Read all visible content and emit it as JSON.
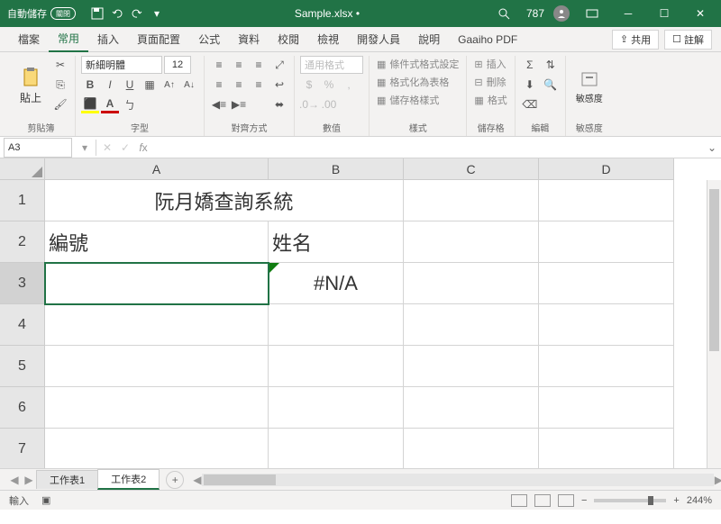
{
  "titlebar": {
    "autosave_label": "自動儲存",
    "autosave_state": "關閉",
    "filename": "Sample.xlsx •",
    "user_count": "787"
  },
  "tabs": {
    "file": "檔案",
    "home": "常用",
    "insert": "插入",
    "layout": "頁面配置",
    "formulas": "公式",
    "data": "資料",
    "review": "校閱",
    "view": "檢視",
    "dev": "開發人員",
    "help": "說明",
    "gaaiho": "Gaaiho PDF",
    "share": "共用",
    "comment": "註解"
  },
  "ribbon": {
    "clipboard": "剪貼簿",
    "paste": "貼上",
    "font_group": "字型",
    "font_name": "新細明體",
    "font_size": "12",
    "align_group": "對齊方式",
    "number_group": "數值",
    "styles_group": "樣式",
    "cells_group": "儲存格",
    "editing_group": "編輯",
    "sens_group": "敏感度",
    "sens_btn": "敏感度",
    "num_fmt": "通用格式",
    "cond_fmt": "條件式格式設定",
    "as_table": "格式化為表格",
    "cell_styles": "儲存格樣式",
    "insert_btn": "插入",
    "delete_btn": "刪除",
    "format_btn": "格式"
  },
  "formula_bar": {
    "name_box": "A3"
  },
  "columns": [
    "A",
    "B",
    "C",
    "D"
  ],
  "rows": [
    "1",
    "2",
    "3",
    "4",
    "5",
    "6",
    "7"
  ],
  "cells": {
    "title": "阮月嬌查詢系統",
    "a2": "編號",
    "b2": "姓名",
    "b3": "#N/A"
  },
  "sheets": {
    "tab1": "工作表1",
    "tab2": "工作表2"
  },
  "status": {
    "mode": "輸入",
    "zoom": "244%"
  }
}
